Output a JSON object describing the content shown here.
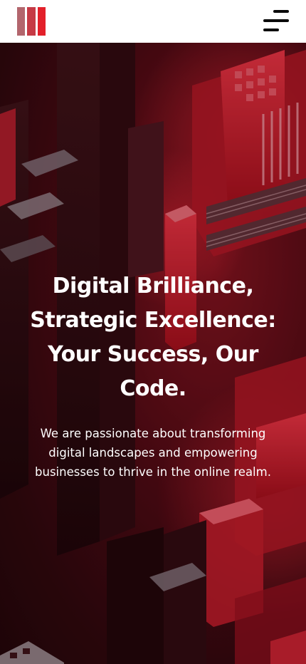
{
  "header": {
    "logo_icon": "logo-bars-icon",
    "menu_icon": "hamburger-menu-icon"
  },
  "hero": {
    "title": "Digital Brilliance, Strategic Excellence: Your Success, Our Code.",
    "subtitle": "We are passionate about transforming digital landscapes and empowering businesses to thrive in the online realm.",
    "background_image": "red-isometric-circuit-city",
    "colors": {
      "accent": "#e3202a",
      "background_dark": "#2a080c",
      "text": "#ffffff"
    }
  }
}
